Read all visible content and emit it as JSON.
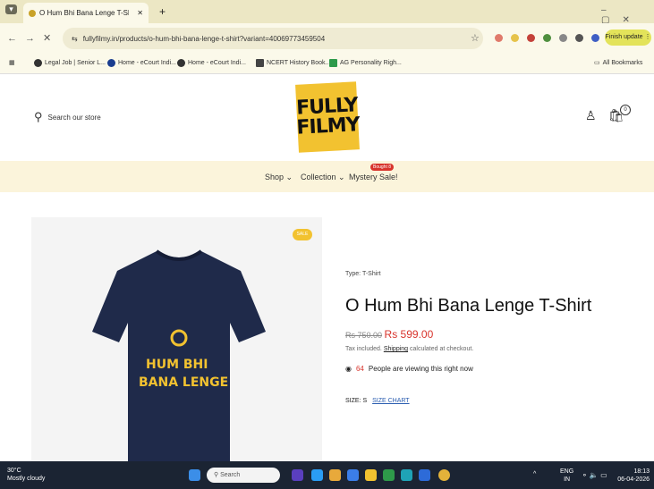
{
  "browser": {
    "tab_title": "O Hum Bhi Bana Lenge T-Shirt",
    "url": "fullyfilmy.in/products/o-hum-bhi-bana-lenge-t-shirt?variant=40069773459504",
    "finish_update_label": "Finish update",
    "bookmarks": [
      "Legal Job | Senior L...",
      "Home - eCourt Indi...",
      "Home - eCourt Indi...",
      "NCERT History Book...",
      "AG Personality Righ..."
    ],
    "all_bookmarks_label": "All Bookmarks"
  },
  "header": {
    "search_placeholder": "Search our store",
    "logo_text_top": "FULLY",
    "logo_text_bottom": "FILMY",
    "cart_count": "0"
  },
  "nav": {
    "items": [
      "Shop",
      "Collection",
      "Mystery Sale!"
    ],
    "badge": "Bought 8"
  },
  "product": {
    "sale_badge": "SALE",
    "type_label": "Type: T-Shirt",
    "title": "O Hum Bhi Bana Lenge T-Shirt",
    "compare_price": "Rs 750.00",
    "sale_price": "Rs 599.00",
    "tax_prefix": "Tax included.",
    "shipping_link": "Shipping",
    "tax_suffix": "calculated at checkout.",
    "viewing_count": "64",
    "viewing_text": "People are viewing this right now",
    "size_label": "SIZE: S",
    "size_chart_link": "SIZE CHART",
    "shirt_text_1": "HUM BHI",
    "shirt_text_2": "BANA LENGE"
  },
  "taskbar": {
    "weather_temp": "30°C",
    "weather_desc": "Mostly cloudy",
    "search_placeholder": "Search",
    "lang_top": "ENG",
    "lang_bottom": "IN",
    "time": "18:13",
    "date": "06-04-2026"
  }
}
